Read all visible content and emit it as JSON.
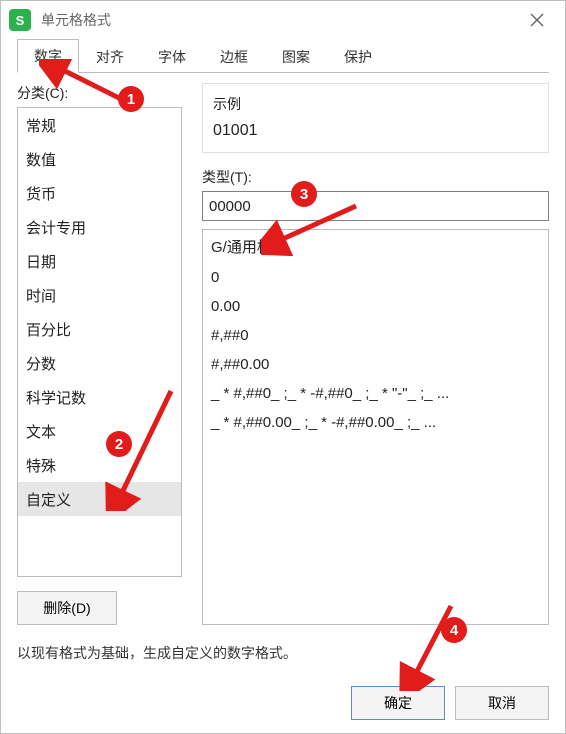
{
  "window": {
    "title": "单元格格式"
  },
  "tabs": {
    "items": [
      "数字",
      "对齐",
      "字体",
      "边框",
      "图案",
      "保护"
    ],
    "active": 0
  },
  "category": {
    "label": "分类(C):",
    "items": [
      "常规",
      "数值",
      "货币",
      "会计专用",
      "日期",
      "时间",
      "百分比",
      "分数",
      "科学记数",
      "文本",
      "特殊",
      "自定义"
    ],
    "selected": 11
  },
  "delete_label": "删除(D)",
  "example": {
    "title": "示例",
    "value": "01001"
  },
  "type": {
    "label": "类型(T):",
    "value": "00000"
  },
  "type_list": [
    "G/通用格式",
    "0",
    "0.00",
    "#,##0",
    "#,##0.00",
    "_ * #,##0_ ;_ * -#,##0_ ;_ * \"-\"_ ;_ ...",
    "_ * #,##0.00_ ;_ * -#,##0.00_ ;_ ..."
  ],
  "hint": "以现有格式为基础，生成自定义的数字格式。",
  "buttons": {
    "ok": "确定",
    "cancel": "取消"
  },
  "annotations": {
    "c1": "1",
    "c2": "2",
    "c3": "3",
    "c4": "4"
  }
}
